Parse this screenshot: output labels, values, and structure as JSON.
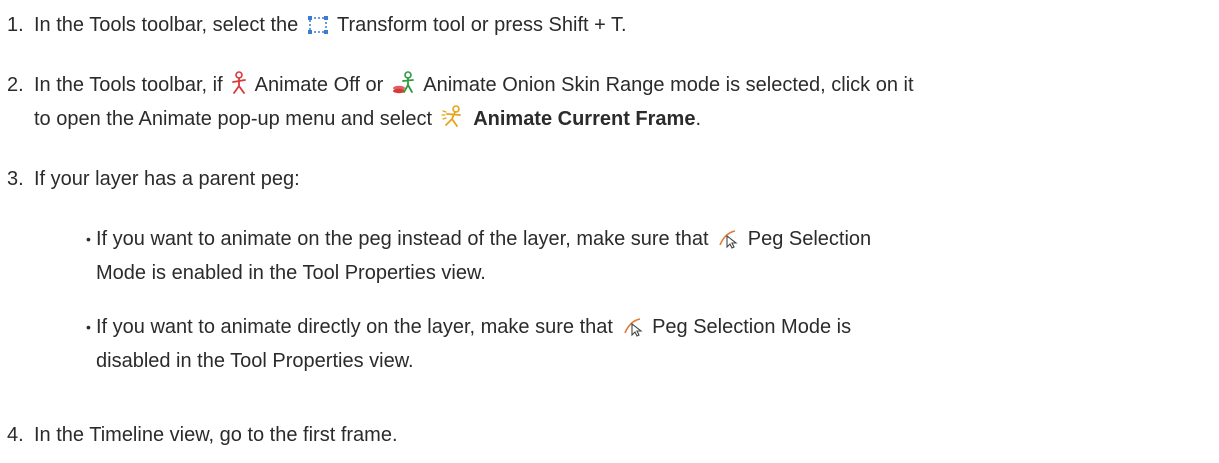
{
  "steps": [
    {
      "number": "1.",
      "before": "In the Tools toolbar, select the",
      "icon1": "transform-tool-icon",
      "after": "Transform tool or press Shift + T."
    },
    {
      "number": "2.",
      "part1": "In the Tools toolbar, if",
      "icon1": "animate-off-icon",
      "part2": "Animate Off or",
      "icon2": "animate-onion-skin-range-icon",
      "part3": "Animate Onion Skin Range mode is selected, click on it",
      "part4": "to open the Animate pop-up menu and select",
      "icon3": "animate-current-frame-icon",
      "bold": "Animate Current Frame",
      "end": "."
    },
    {
      "number": "3.",
      "text": "If your layer has a parent peg:"
    },
    {
      "number": "4.",
      "text": "In the Timeline view, go to the first frame."
    }
  ],
  "bullets": [
    {
      "bullet": "•",
      "part1": "If you want to animate on the peg instead of the layer, make sure that",
      "icon": "peg-selection-mode-icon",
      "part2": "Peg Selection",
      "part3": "Mode is enabled in the Tool Properties view."
    },
    {
      "bullet": "•",
      "part1": "If you want to animate directly on the layer, make sure that",
      "icon": "peg-selection-mode-icon",
      "part2": "Peg Selection Mode is",
      "part3": "disabled in the Tool Properties view."
    }
  ],
  "colors": {
    "text": "#2b2b2b",
    "animate_red": "#d83a3a",
    "animate_orange": "#e8a317",
    "transform_blue": "#3a7bd5"
  }
}
